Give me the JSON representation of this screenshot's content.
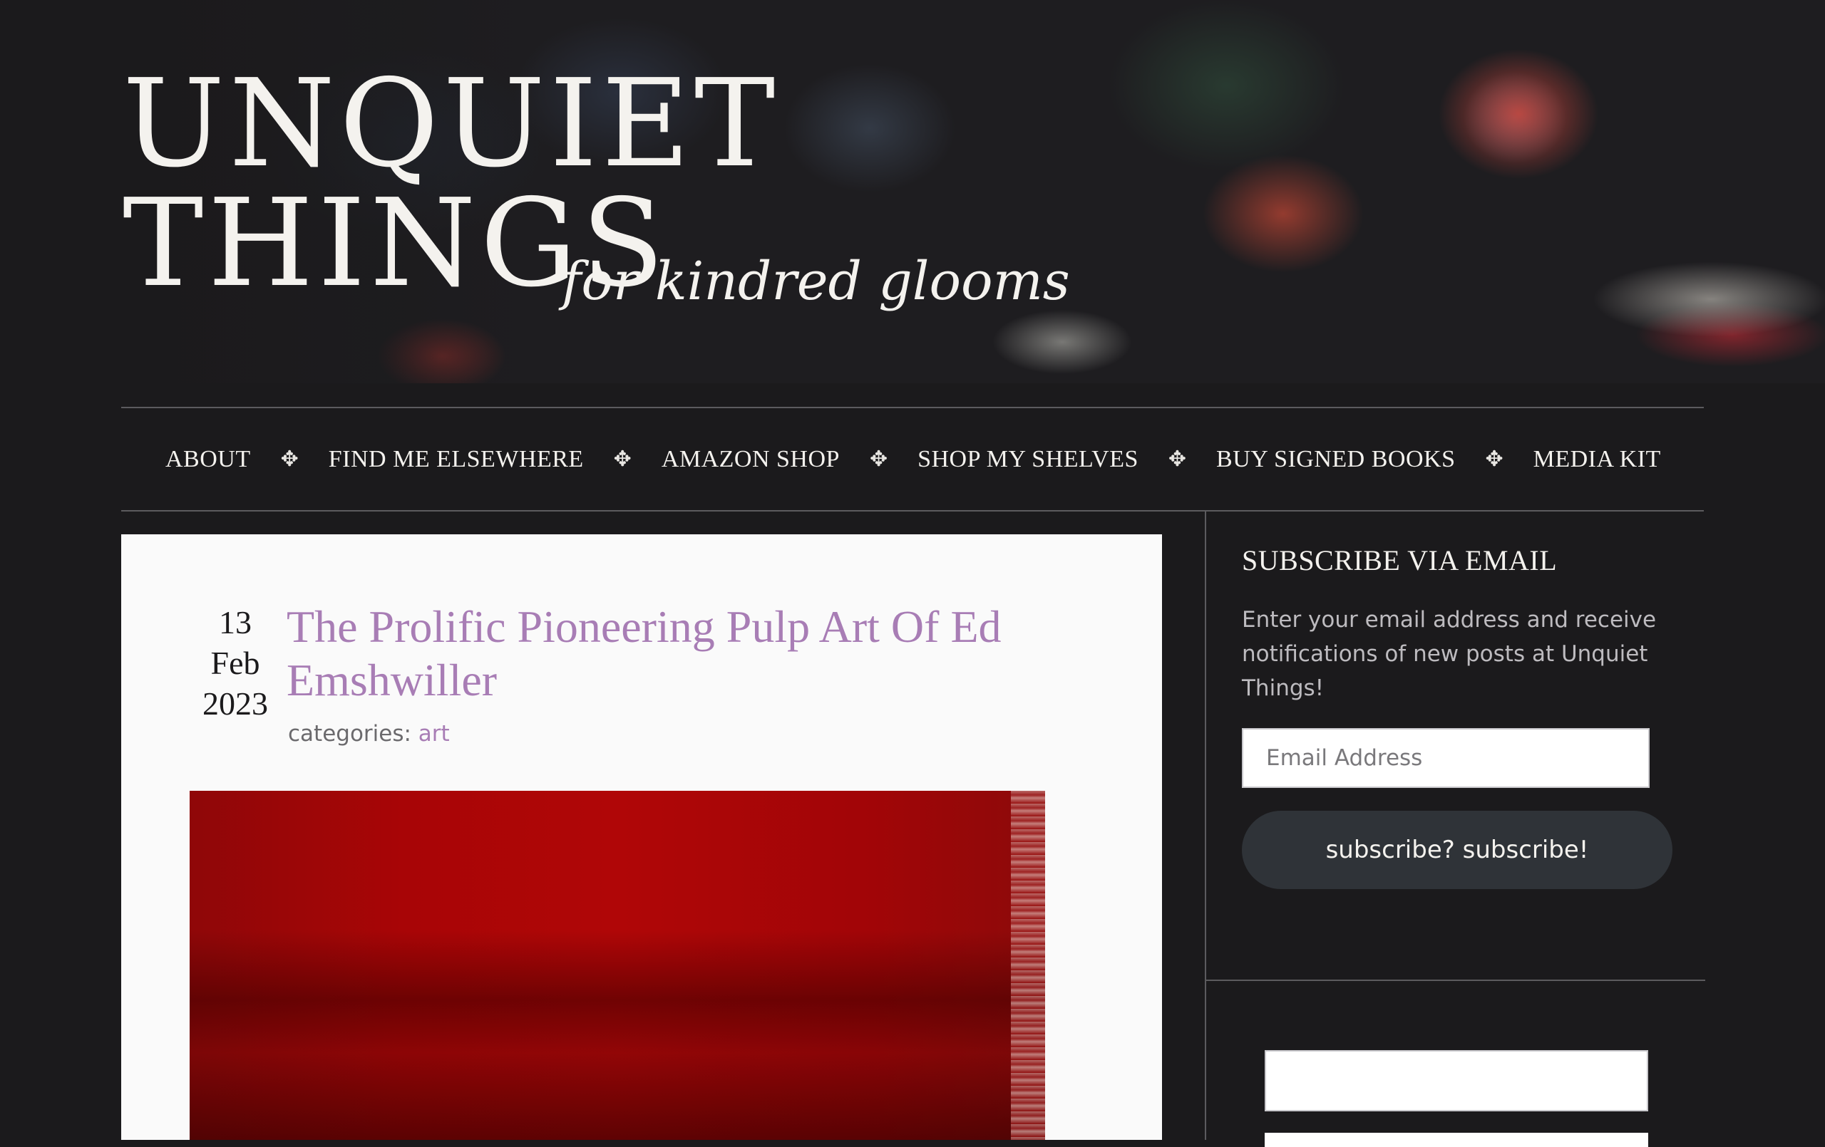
{
  "header": {
    "title_line1": "UNQUIET",
    "title_line2": "THINGS",
    "tagline": "for kindred glooms"
  },
  "nav": {
    "items": [
      {
        "label": "ABOUT"
      },
      {
        "label": "FIND ME ELSEWHERE"
      },
      {
        "label": "AMAZON SHOP"
      },
      {
        "label": "SHOP MY SHELVES"
      },
      {
        "label": "BUY SIGNED BOOKS"
      },
      {
        "label": "MEDIA KIT"
      }
    ],
    "separator": "✥"
  },
  "post": {
    "date_day": "13",
    "date_month": "Feb",
    "date_year": "2023",
    "title": "The Prolific Pioneering Pulp Art Of Ed Emshwiller",
    "categories_label": "categories: ",
    "category": "art"
  },
  "sidebar": {
    "subscribe_title": "SUBSCRIBE VIA EMAIL",
    "subscribe_desc": "Enter your email address and receive notifications of new posts at Unquiet Things!",
    "email_placeholder": "Email Address",
    "subscribe_button": "subscribe? subscribe!"
  },
  "colors": {
    "background": "#1b1a1c",
    "accent_purple": "#a87db5",
    "card_bg": "#fafafa",
    "button_bg": "#2f3338"
  }
}
